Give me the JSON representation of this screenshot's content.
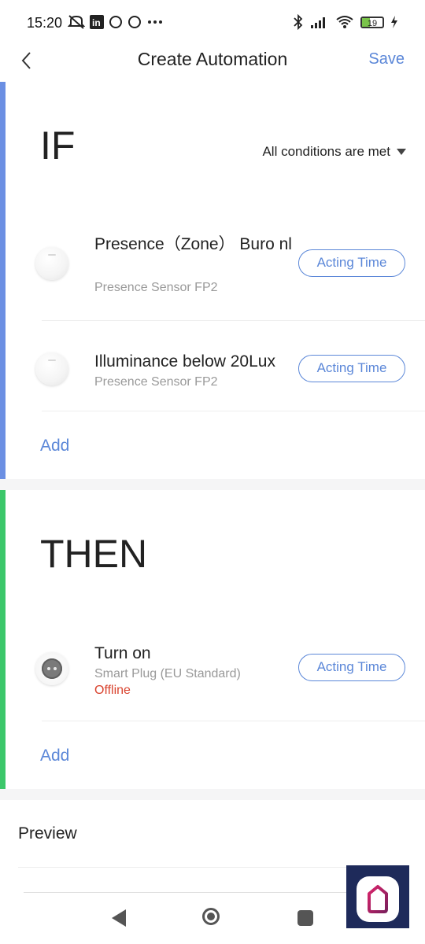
{
  "status_bar": {
    "time": "15:20",
    "icons_left": [
      "mute-icon",
      "linkedin-icon",
      "circle-icon",
      "circle-icon",
      "more-icon"
    ],
    "icons_right": [
      "bluetooth-icon",
      "signal-icon",
      "wifi-icon",
      "battery-icon",
      "charging-icon"
    ],
    "battery_level": "19"
  },
  "header": {
    "title": "Create Automation",
    "save_label": "Save"
  },
  "if_section": {
    "label": "IF",
    "accent_color": "#6b8fe3",
    "condition_mode": "All conditions are met",
    "items": [
      {
        "title": "Presence（Zone） Buro nl",
        "subtitle": "Presence Sensor FP2",
        "button_label": "Acting Time"
      },
      {
        "title": "Illuminance below 20Lux",
        "subtitle": "Presence Sensor FP2",
        "button_label": "Acting Time"
      }
    ],
    "add_label": "Add"
  },
  "then_section": {
    "label": "THEN",
    "accent_color": "#3cc76a",
    "items": [
      {
        "title": "Turn on",
        "subtitle": "Smart Plug (EU Standard)",
        "status": "Offline",
        "button_label": "Acting Time"
      }
    ],
    "add_label": "Add"
  },
  "preview_label": "Preview",
  "colors": {
    "accent": "#5b87d8",
    "offline": "#d9432e",
    "section_gap": "#f5f5f6"
  }
}
